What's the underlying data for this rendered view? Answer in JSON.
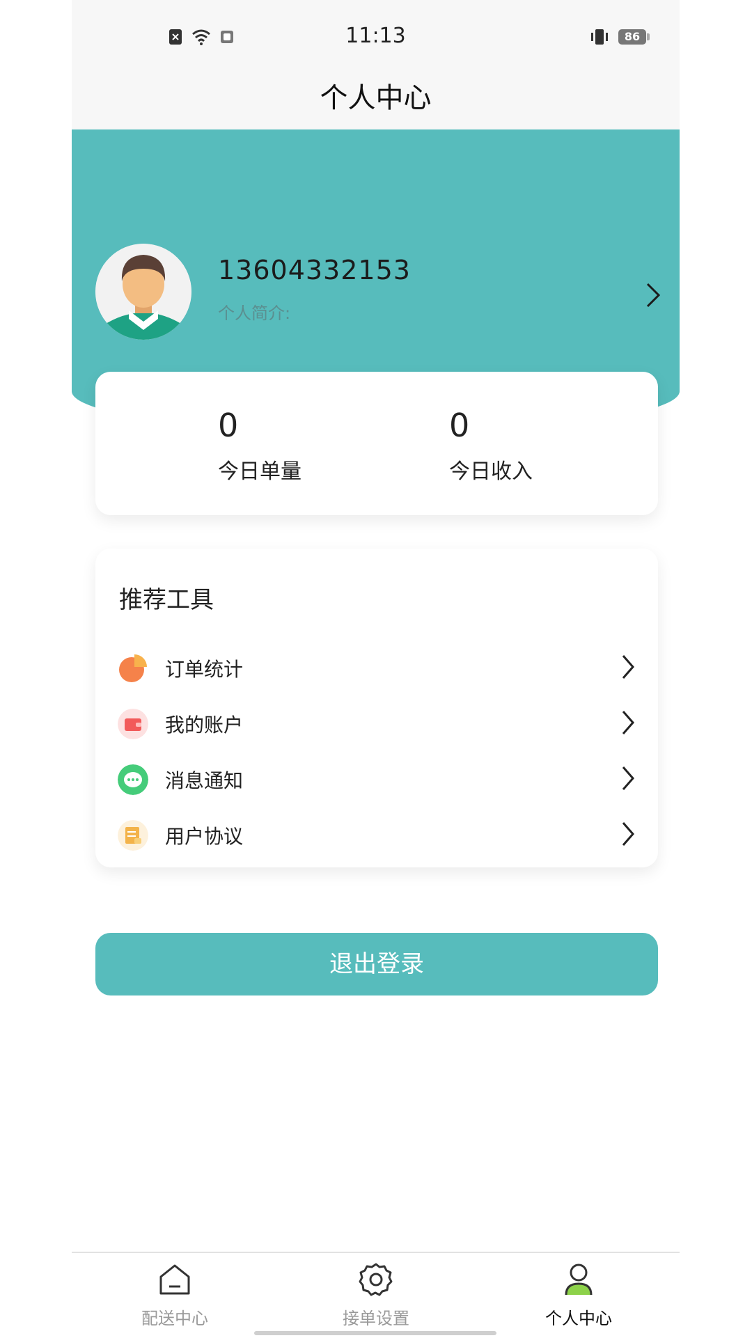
{
  "status_bar": {
    "time": "11:13",
    "battery": "86",
    "icons": [
      "sim-x-icon",
      "wifi-icon",
      "cast-icon",
      "vibrate-icon",
      "battery-icon"
    ]
  },
  "header": {
    "title": "个人中心"
  },
  "profile": {
    "phone": "13604332153",
    "bio_label": "个人简介:"
  },
  "stats": {
    "orders_value": "0",
    "orders_label": "今日单量",
    "income_value": "0",
    "income_label": "今日收入"
  },
  "tools": {
    "title": "推荐工具",
    "items": [
      {
        "label": "订单统计",
        "icon": "pie-chart-icon",
        "color": "#f5824a"
      },
      {
        "label": "我的账户",
        "icon": "wallet-icon",
        "color": "#f25a5a"
      },
      {
        "label": "消息通知",
        "icon": "chat-bubble-icon",
        "color": "#45cc7a"
      },
      {
        "label": "用户协议",
        "icon": "document-icon",
        "color": "#f3b34a"
      }
    ]
  },
  "logout_label": "退出登录",
  "bottom_nav": {
    "items": [
      {
        "label": "配送中心",
        "icon": "home-icon",
        "active": false
      },
      {
        "label": "接单设置",
        "icon": "gear-icon",
        "active": false
      },
      {
        "label": "个人中心",
        "icon": "person-icon",
        "active": true
      }
    ]
  },
  "colors": {
    "accent": "#57bcbc"
  }
}
